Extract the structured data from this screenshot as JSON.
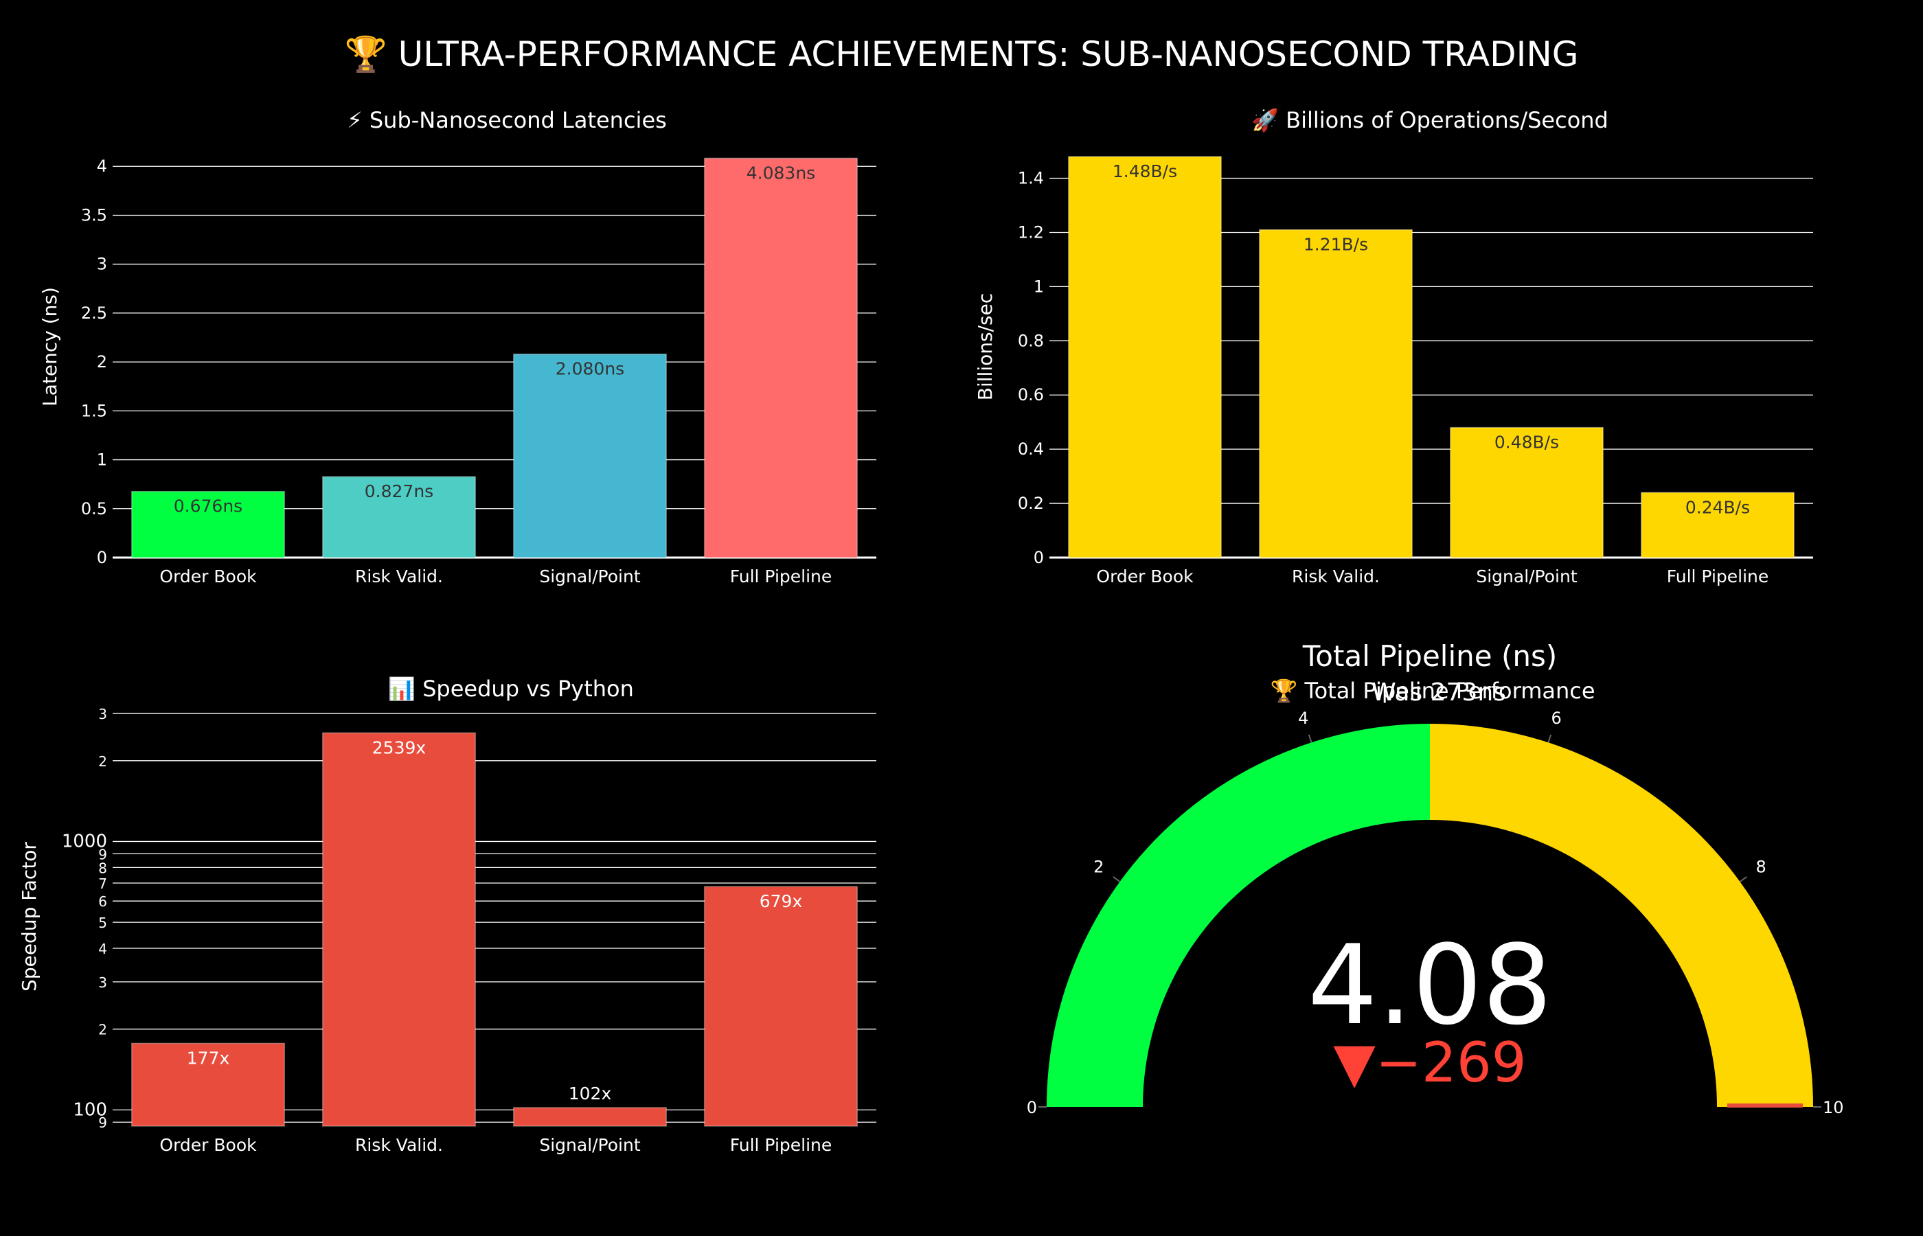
{
  "title": "🏆 ULTRA-PERFORMANCE ACHIEVEMENTS: SUB-NANOSECOND TRADING",
  "colors": {
    "background": "#000000",
    "grid": "#ffffff",
    "green": "#00ff41",
    "teal": "#4ecdc4",
    "blue": "#45b7d1",
    "coral": "#ff6b6b",
    "gold": "#ffd700",
    "red": "#e74c3c",
    "delta_red": "#ff4136"
  },
  "chart_data": [
    {
      "id": "latency",
      "type": "bar",
      "title": "⚡ Sub-Nanosecond Latencies",
      "ylabel": "Latency (ns)",
      "xlabel": "",
      "categories": [
        "Order Book",
        "Risk Valid.",
        "Signal/Point",
        "Full Pipeline"
      ],
      "values": [
        0.676,
        0.827,
        2.08,
        4.083
      ],
      "labels": [
        "0.676ns",
        "0.827ns",
        "2.080ns",
        "4.083ns"
      ],
      "bar_colors": [
        "#00ff41",
        "#4ecdc4",
        "#45b7d1",
        "#ff6b6b"
      ],
      "ylim": [
        0,
        4.1
      ],
      "yticks": [
        0,
        0.5,
        1,
        1.5,
        2,
        2.5,
        3,
        3.5,
        4
      ],
      "ytick_labels": [
        "0",
        "0.5",
        "1",
        "1.5",
        "2",
        "2.5",
        "3",
        "3.5",
        "4"
      ],
      "grid": true
    },
    {
      "id": "throughput",
      "type": "bar",
      "title": "🚀 Billions of Operations/Second",
      "ylabel": "Billions/sec",
      "xlabel": "",
      "categories": [
        "Order Book",
        "Risk Valid.",
        "Signal/Point",
        "Full Pipeline"
      ],
      "values": [
        1.48,
        1.21,
        0.48,
        0.24
      ],
      "labels": [
        "1.48B/s",
        "1.21B/s",
        "0.48B/s",
        "0.24B/s"
      ],
      "bar_colors": [
        "#ffd700",
        "#ffd700",
        "#ffd700",
        "#ffd700"
      ],
      "ylim": [
        0,
        1.48
      ],
      "yticks": [
        0,
        0.2,
        0.4,
        0.6,
        0.8,
        1,
        1.2,
        1.4
      ],
      "ytick_labels": [
        "0",
        "0.2",
        "0.4",
        "0.6",
        "0.8",
        "1",
        "1.2",
        "1.4"
      ],
      "grid": true
    },
    {
      "id": "speedup",
      "type": "bar",
      "scale": "log",
      "title": "📊 Speedup vs Python",
      "ylabel": "Speedup Factor",
      "xlabel": "",
      "categories": [
        "Order Book",
        "Risk Valid.",
        "Signal/Point",
        "Full Pipeline"
      ],
      "values": [
        177,
        2539,
        102,
        679
      ],
      "labels": [
        "177x",
        "2539x",
        "102x",
        "679x"
      ],
      "bar_colors": [
        "#e74c3c",
        "#e74c3c",
        "#e74c3c",
        "#e74c3c"
      ],
      "ylim": [
        87,
        3200
      ],
      "yticks": [
        90,
        100,
        200,
        300,
        400,
        500,
        600,
        700,
        800,
        900,
        1000,
        2000,
        3000
      ],
      "ytick_labels": [
        "9",
        "100",
        "2",
        "3",
        "4",
        "5",
        "6",
        "7",
        "8",
        "9",
        "1000",
        "2",
        "3"
      ],
      "grid": true
    },
    {
      "id": "gauge",
      "type": "gauge",
      "title": "🏆 Total Pipeline Performance",
      "gauge_title": "Total Pipeline (ns)",
      "gauge_subtitle": "Was 273ns",
      "value": 4.08,
      "value_label": "4.08",
      "delta": -269,
      "delta_label": "▼−269",
      "range": [
        0,
        10
      ],
      "ticks": [
        0,
        2,
        4,
        6,
        8,
        10
      ],
      "tick_labels": [
        "0",
        "2",
        "4",
        "6",
        "8",
        "10"
      ],
      "steps": [
        {
          "from": 0,
          "to": 5,
          "color": "#00ff41"
        },
        {
          "from": 5,
          "to": 10,
          "color": "#ffd700"
        }
      ],
      "threshold": 10,
      "threshold_color": "#e74c3c"
    }
  ]
}
